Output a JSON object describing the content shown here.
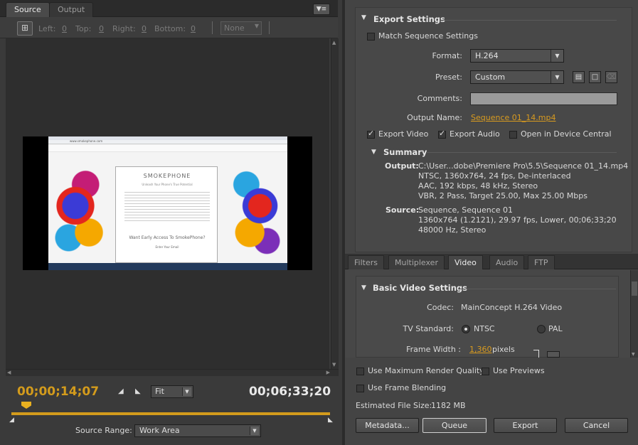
{
  "source_panel": {
    "tabs": [
      "Source",
      "Output"
    ],
    "crop": {
      "left_label": "Left:",
      "left": "0",
      "top_label": "Top:",
      "top": "0",
      "right_label": "Right:",
      "right": "0",
      "bottom_label": "Bottom:",
      "bottom": "0",
      "ratio": "None"
    },
    "timecode_current": "00;00;14;07",
    "timecode_duration": "00;06;33;20",
    "zoom": "Fit",
    "source_range_label": "Source Range:",
    "source_range": "Work Area",
    "preview": {
      "brand": "SMOKEPHONE",
      "tagline": "Unleash Your Phone's True Potential",
      "cta": "Want Early Access To SmokePhone?",
      "email_label": "Enter Your Email",
      "url": "www.smokephone.com"
    }
  },
  "export_settings": {
    "title": "Export Settings",
    "match_sequence": "Match Sequence Settings",
    "format_label": "Format:",
    "format": "H.264",
    "preset_label": "Preset:",
    "preset": "Custom",
    "comments_label": "Comments:",
    "output_name_label": "Output Name:",
    "output_name": "Sequence 01_14.mp4",
    "export_video": "Export Video",
    "export_audio": "Export Audio",
    "open_device": "Open in Device Central"
  },
  "summary": {
    "title": "Summary",
    "output_label": "Output:",
    "output_lines": [
      "C:\\User...dobe\\Premiere Pro\\5.5\\Sequence 01_14.mp4",
      "NTSC, 1360x764, 24 fps, De-interlaced",
      "AAC, 192 kbps, 48 kHz, Stereo",
      "VBR, 2 Pass, Target 25.00, Max 25.00 Mbps"
    ],
    "source_label": "Source:",
    "source_lines": [
      "Sequence, Sequence 01",
      "1360x764 (1.2121), 29.97 fps, Lower, 00;06;33;20",
      "48000 Hz, Stereo"
    ]
  },
  "settings_tabs": [
    "Filters",
    "Multiplexer",
    "Video",
    "Audio",
    "FTP"
  ],
  "video": {
    "title": "Basic Video Settings",
    "codec_label": "Codec:",
    "codec": "MainConcept H.264 Video",
    "tv_label": "TV Standard:",
    "ntsc": "NTSC",
    "pal": "PAL",
    "frame_width_label": "Frame Width :",
    "frame_width": "1,360",
    "pixels": "pixels"
  },
  "footer": {
    "max_render": "Use Maximum Render Quality",
    "use_previews": "Use Previews",
    "frame_blending": "Use Frame Blending",
    "file_size_label": "Estimated File Size:",
    "file_size": "1182 MB",
    "metadata": "Metadata...",
    "queue": "Queue",
    "export": "Export",
    "cancel": "Cancel"
  }
}
